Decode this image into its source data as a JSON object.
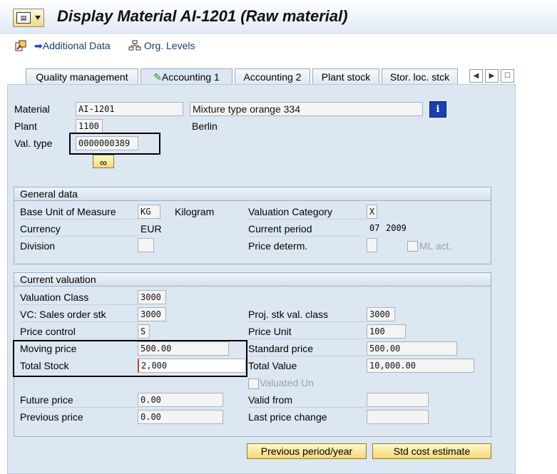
{
  "window": {
    "title": "Display Material AI-1201 (Raw material)"
  },
  "toolbar": {
    "additional_data": "Additional Data",
    "org_levels": "Org. Levels"
  },
  "tabs": [
    {
      "label": "Quality management",
      "active": false
    },
    {
      "label": "Accounting 1",
      "active": true
    },
    {
      "label": "Accounting 2",
      "active": false
    },
    {
      "label": "Plant stock",
      "active": false
    },
    {
      "label": "Stor. loc. stck",
      "active": false
    }
  ],
  "header": {
    "material_label": "Material",
    "material_value": "AI-1201",
    "material_desc": "Mixture type orange 334",
    "plant_label": "Plant",
    "plant_value": "1100",
    "plant_name": "Berlin",
    "valtype_label": "Val. type",
    "valtype_value": "0000000389"
  },
  "general": {
    "title": "General data",
    "base_uom_label": "Base Unit of Measure",
    "base_uom_value": "KG",
    "base_uom_text": "Kilogram",
    "valcat_label": "Valuation Category",
    "valcat_value": "X",
    "currency_label": "Currency",
    "currency_value": "EUR",
    "period_label": "Current period",
    "period_month": "07",
    "period_year": "2009",
    "division_label": "Division",
    "division_value": "",
    "pricedet_label": "Price determ.",
    "pricedet_value": "",
    "ml_label": "ML act."
  },
  "valuation": {
    "title": "Current valuation",
    "valclass_label": "Valuation Class",
    "valclass_value": "3000",
    "vc_sales_label": "VC: Sales order stk",
    "vc_sales_value": "3000",
    "proj_label": "Proj. stk val. class",
    "proj_value": "3000",
    "pricectl_label": "Price control",
    "pricectl_value": "S",
    "priceunit_label": "Price Unit",
    "priceunit_value": "100",
    "moving_label": "Moving price",
    "moving_value": "500.00",
    "std_label": "Standard price",
    "std_value": "500.00",
    "totstock_label": "Total Stock",
    "totstock_value": "2,000",
    "totvalue_label": "Total Value",
    "totvalue_value": "10,000.00",
    "valued_un_label": "Valuated Un",
    "future_label": "Future price",
    "future_value": "0.00",
    "validfrom_label": "Valid from",
    "validfrom_value": "",
    "prev_label": "Previous price",
    "prev_value": "0.00",
    "lastchange_label": "Last price change",
    "lastchange_value": ""
  },
  "buttons": {
    "prev_period": "Previous period/year",
    "std_cost": "Std cost estimate"
  },
  "colors": {
    "accent": "#dde7f1",
    "button": "#f3d874",
    "info_icon": "#1a3fae"
  }
}
